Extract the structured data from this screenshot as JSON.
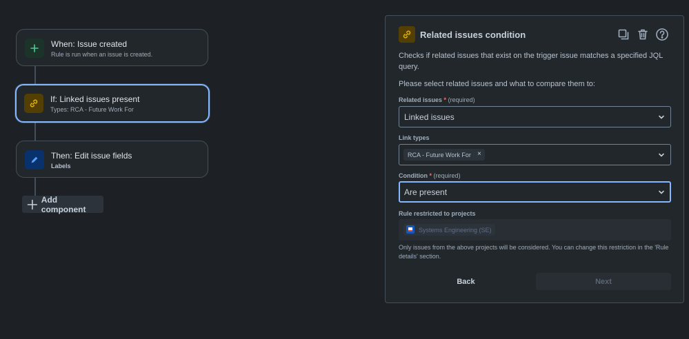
{
  "flow": {
    "trigger": {
      "title": "When: Issue created",
      "subtitle": "Rule is run when an issue is created.",
      "icon": "plus-icon"
    },
    "condition": {
      "title": "If: Linked issues present",
      "subtitle": "Types: RCA - Future Work For",
      "icon": "link-icon"
    },
    "action": {
      "title": "Then: Edit issue fields",
      "subtitle": "Labels",
      "icon": "pencil-icon"
    },
    "add_component_label": "Add component"
  },
  "panel": {
    "title": "Related issues condition",
    "icon": "link-icon",
    "tools": [
      "duplicate-icon",
      "trash-icon",
      "help-icon"
    ],
    "description": "Checks if related issues that exist on the trigger issue matches a specified JQL query.",
    "instruction": "Please select related issues and what to compare them to:",
    "required_mark": "*",
    "required_text": "(required)",
    "related_issues": {
      "label": "Related issues",
      "value": "Linked issues"
    },
    "link_types": {
      "label": "Link types",
      "chip": "RCA - Future Work For",
      "chip_remove": "×"
    },
    "condition": {
      "label": "Condition",
      "value": "Are present"
    },
    "restricted": {
      "label": "Rule restricted to projects",
      "project": "Systems Engineering (SE)"
    },
    "note": "Only issues from the above projects will be considered. You can change this restriction in the 'Rule details' section.",
    "back_label": "Back",
    "next_label": "Next"
  },
  "colors": {
    "background": "#1d2125",
    "focus": "#85b8ff",
    "success": "#4bce97",
    "warning": "#e2b203",
    "info": "#579dff"
  }
}
